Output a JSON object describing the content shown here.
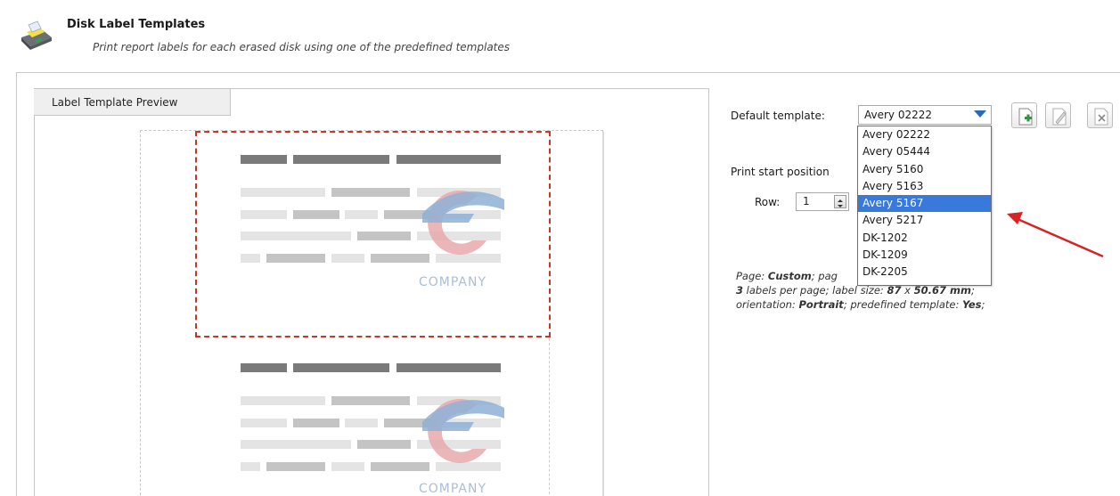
{
  "header": {
    "title": "Disk Label Templates",
    "subtitle": "Print report labels for each erased disk using one of the predefined templates",
    "icon": "printer-icon"
  },
  "preview": {
    "tab_label": "Label Template Preview",
    "logo_text_1": "COMPANY",
    "logo_text_2": "COMPANY"
  },
  "template": {
    "label": "Default template:",
    "selected_value": "Avery 02222",
    "options": [
      "Avery 02222",
      "Avery 05444",
      "Avery 5160",
      "Avery 5163",
      "Avery 5167",
      "Avery 5217",
      "DK-1202",
      "DK-1209",
      "DK-2205"
    ],
    "highlighted_option": "Avery 5167"
  },
  "toolbar": {
    "add_icon": "add-template-icon",
    "edit_icon": "edit-template-icon",
    "delete_icon": "delete-template-icon"
  },
  "start_position": {
    "label": "Print start position",
    "row_label": "Row:",
    "row_value": "1"
  },
  "details": {
    "page_prefix": "Page: ",
    "page_value": "Custom",
    "page_tail": "; pag",
    "labels_count": "3",
    "labels_text": " labels per page; label size: ",
    "size_value": "87",
    "size_x": " x ",
    "size_value2": "50.67 mm",
    "orientation_prefix": "; orientation: ",
    "orientation_value": "Portrait",
    "predefined_prefix": "; predefined template: ",
    "predefined_value": "Yes",
    "end": ";"
  },
  "colors": {
    "selection": "#3879d9",
    "label_outline": "#c0392b",
    "arrow": "#d62424"
  }
}
